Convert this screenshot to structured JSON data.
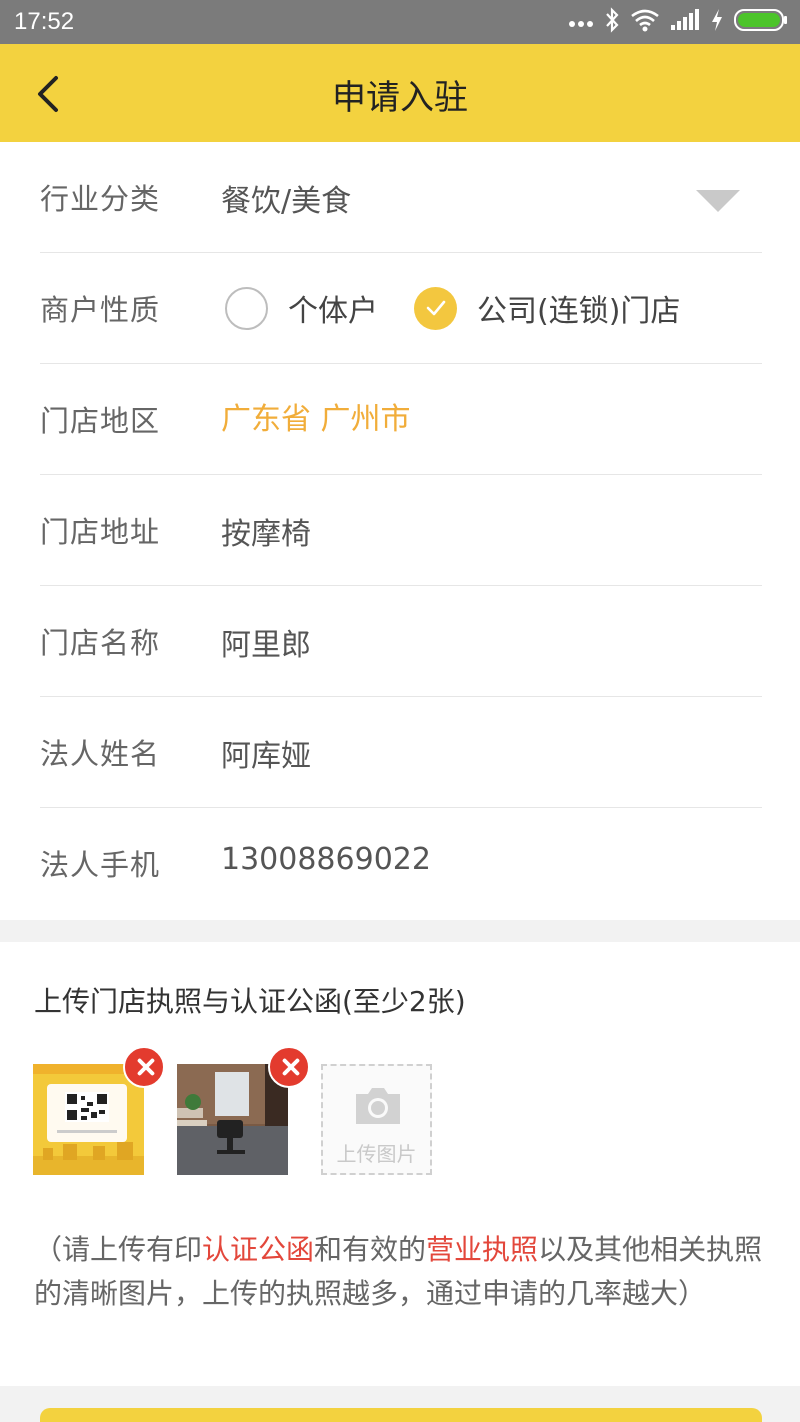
{
  "status_bar": {
    "time": "17:52",
    "icons": [
      "more-dots-icon",
      "bluetooth-icon",
      "wifi-icon",
      "signal-icon",
      "charging-icon",
      "battery-icon"
    ]
  },
  "nav": {
    "title": "申请入驻",
    "back_icon": "chevron-left-icon",
    "background": "#f3d23f"
  },
  "form": {
    "industry": {
      "label": "行业分类",
      "value": "餐饮/美食"
    },
    "merchant_type": {
      "label": "商户性质",
      "options": [
        {
          "label": "个体户",
          "selected": false
        },
        {
          "label": "公司(连锁)门店",
          "selected": true
        }
      ]
    },
    "region": {
      "label": "门店地区",
      "value": "广东省 广州市"
    },
    "address": {
      "label": "门店地址",
      "value": "按摩椅"
    },
    "store_name": {
      "label": "门店名称",
      "value": "阿里郎"
    },
    "legal_name": {
      "label": "法人姓名",
      "value": "阿库娅"
    },
    "legal_phone": {
      "label": "法人手机",
      "value": "13008869022"
    }
  },
  "upload": {
    "title": "上传门店执照与认证公函(至少2张)",
    "upload_box_label": "上传图片",
    "images": [
      "qr-code-poster",
      "office-photo"
    ],
    "note_parts": [
      "（请上传有印",
      "认证公函",
      "和有效的",
      "营业执照",
      "以及其他相关执照的清晰图片，上传的执照越多，通过申请的几率越大）"
    ]
  },
  "colors": {
    "accent": "#f3d23f",
    "region_text": "#f1ad3a",
    "highlight_red": "#e3473b",
    "delete_red": "#e33b2e"
  }
}
